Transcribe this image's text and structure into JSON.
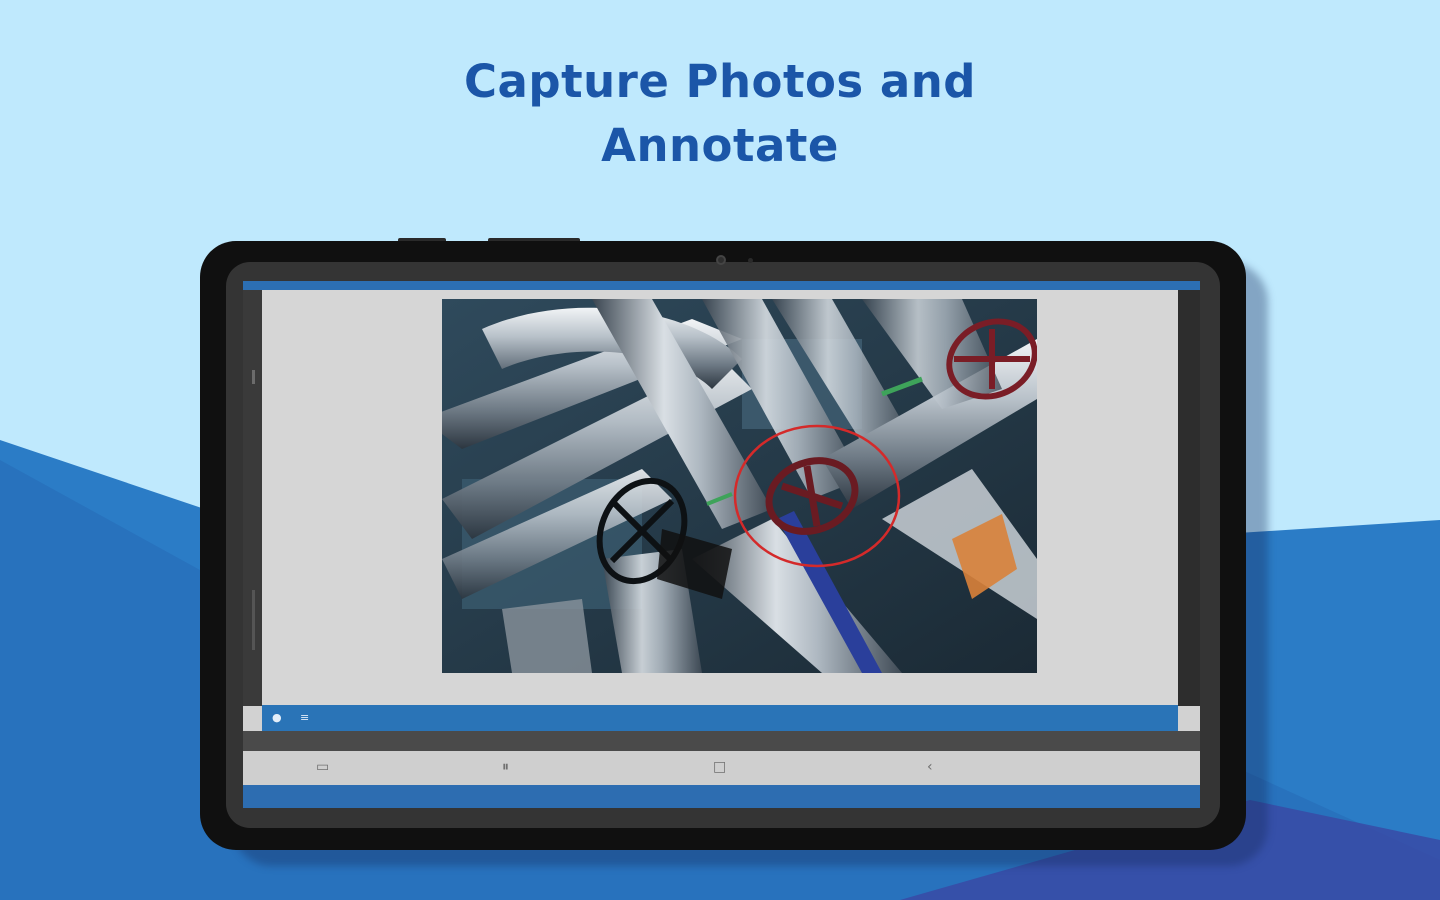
{
  "headline": {
    "line1": "Capture Photos and",
    "line2": "Annotate"
  },
  "colors": {
    "sky": "#bfe9fd",
    "headline": "#1b56a8",
    "wave_light": "#2a7fc9",
    "wave_dark": "#1f5ba8",
    "app_accent": "#2a74b7",
    "annotation": "#d42a2a",
    "tablet_frame": "#101010"
  },
  "app": {
    "toolbar": {
      "comment_icon": "comment-icon",
      "menu_icon": "menu-icon"
    },
    "photo": {
      "subject": "industrial-pipes-with-valves",
      "annotation_shape": "circle"
    }
  },
  "system_nav": {
    "recent_apps_icon": "recent-apps-icon",
    "multitask_icon": "multitask-icon",
    "home_icon": "home-icon",
    "back_icon": "back-icon"
  }
}
